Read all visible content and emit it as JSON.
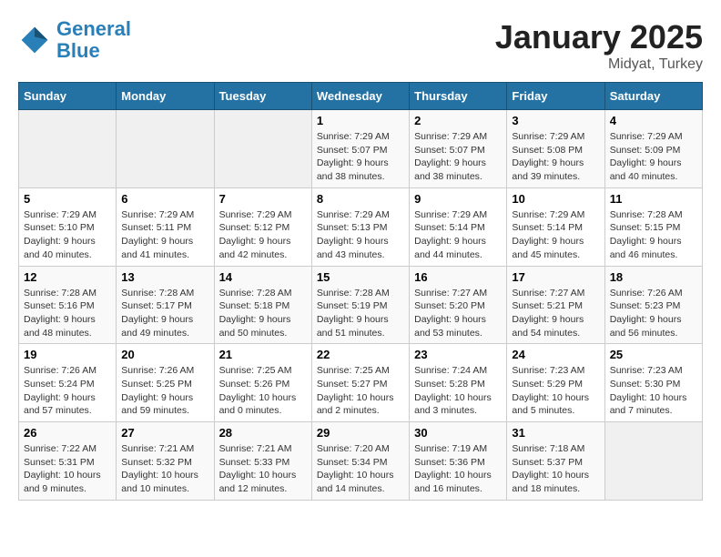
{
  "header": {
    "logo_line1": "General",
    "logo_line2": "Blue",
    "month": "January 2025",
    "location": "Midyat, Turkey"
  },
  "weekdays": [
    "Sunday",
    "Monday",
    "Tuesday",
    "Wednesday",
    "Thursday",
    "Friday",
    "Saturday"
  ],
  "weeks": [
    [
      {
        "day": "",
        "info": ""
      },
      {
        "day": "",
        "info": ""
      },
      {
        "day": "",
        "info": ""
      },
      {
        "day": "1",
        "info": "Sunrise: 7:29 AM\nSunset: 5:07 PM\nDaylight: 9 hours\nand 38 minutes."
      },
      {
        "day": "2",
        "info": "Sunrise: 7:29 AM\nSunset: 5:07 PM\nDaylight: 9 hours\nand 38 minutes."
      },
      {
        "day": "3",
        "info": "Sunrise: 7:29 AM\nSunset: 5:08 PM\nDaylight: 9 hours\nand 39 minutes."
      },
      {
        "day": "4",
        "info": "Sunrise: 7:29 AM\nSunset: 5:09 PM\nDaylight: 9 hours\nand 40 minutes."
      }
    ],
    [
      {
        "day": "5",
        "info": "Sunrise: 7:29 AM\nSunset: 5:10 PM\nDaylight: 9 hours\nand 40 minutes."
      },
      {
        "day": "6",
        "info": "Sunrise: 7:29 AM\nSunset: 5:11 PM\nDaylight: 9 hours\nand 41 minutes."
      },
      {
        "day": "7",
        "info": "Sunrise: 7:29 AM\nSunset: 5:12 PM\nDaylight: 9 hours\nand 42 minutes."
      },
      {
        "day": "8",
        "info": "Sunrise: 7:29 AM\nSunset: 5:13 PM\nDaylight: 9 hours\nand 43 minutes."
      },
      {
        "day": "9",
        "info": "Sunrise: 7:29 AM\nSunset: 5:14 PM\nDaylight: 9 hours\nand 44 minutes."
      },
      {
        "day": "10",
        "info": "Sunrise: 7:29 AM\nSunset: 5:14 PM\nDaylight: 9 hours\nand 45 minutes."
      },
      {
        "day": "11",
        "info": "Sunrise: 7:28 AM\nSunset: 5:15 PM\nDaylight: 9 hours\nand 46 minutes."
      }
    ],
    [
      {
        "day": "12",
        "info": "Sunrise: 7:28 AM\nSunset: 5:16 PM\nDaylight: 9 hours\nand 48 minutes."
      },
      {
        "day": "13",
        "info": "Sunrise: 7:28 AM\nSunset: 5:17 PM\nDaylight: 9 hours\nand 49 minutes."
      },
      {
        "day": "14",
        "info": "Sunrise: 7:28 AM\nSunset: 5:18 PM\nDaylight: 9 hours\nand 50 minutes."
      },
      {
        "day": "15",
        "info": "Sunrise: 7:28 AM\nSunset: 5:19 PM\nDaylight: 9 hours\nand 51 minutes."
      },
      {
        "day": "16",
        "info": "Sunrise: 7:27 AM\nSunset: 5:20 PM\nDaylight: 9 hours\nand 53 minutes."
      },
      {
        "day": "17",
        "info": "Sunrise: 7:27 AM\nSunset: 5:21 PM\nDaylight: 9 hours\nand 54 minutes."
      },
      {
        "day": "18",
        "info": "Sunrise: 7:26 AM\nSunset: 5:23 PM\nDaylight: 9 hours\nand 56 minutes."
      }
    ],
    [
      {
        "day": "19",
        "info": "Sunrise: 7:26 AM\nSunset: 5:24 PM\nDaylight: 9 hours\nand 57 minutes."
      },
      {
        "day": "20",
        "info": "Sunrise: 7:26 AM\nSunset: 5:25 PM\nDaylight: 9 hours\nand 59 minutes."
      },
      {
        "day": "21",
        "info": "Sunrise: 7:25 AM\nSunset: 5:26 PM\nDaylight: 10 hours\nand 0 minutes."
      },
      {
        "day": "22",
        "info": "Sunrise: 7:25 AM\nSunset: 5:27 PM\nDaylight: 10 hours\nand 2 minutes."
      },
      {
        "day": "23",
        "info": "Sunrise: 7:24 AM\nSunset: 5:28 PM\nDaylight: 10 hours\nand 3 minutes."
      },
      {
        "day": "24",
        "info": "Sunrise: 7:23 AM\nSunset: 5:29 PM\nDaylight: 10 hours\nand 5 minutes."
      },
      {
        "day": "25",
        "info": "Sunrise: 7:23 AM\nSunset: 5:30 PM\nDaylight: 10 hours\nand 7 minutes."
      }
    ],
    [
      {
        "day": "26",
        "info": "Sunrise: 7:22 AM\nSunset: 5:31 PM\nDaylight: 10 hours\nand 9 minutes."
      },
      {
        "day": "27",
        "info": "Sunrise: 7:21 AM\nSunset: 5:32 PM\nDaylight: 10 hours\nand 10 minutes."
      },
      {
        "day": "28",
        "info": "Sunrise: 7:21 AM\nSunset: 5:33 PM\nDaylight: 10 hours\nand 12 minutes."
      },
      {
        "day": "29",
        "info": "Sunrise: 7:20 AM\nSunset: 5:34 PM\nDaylight: 10 hours\nand 14 minutes."
      },
      {
        "day": "30",
        "info": "Sunrise: 7:19 AM\nSunset: 5:36 PM\nDaylight: 10 hours\nand 16 minutes."
      },
      {
        "day": "31",
        "info": "Sunrise: 7:18 AM\nSunset: 5:37 PM\nDaylight: 10 hours\nand 18 minutes."
      },
      {
        "day": "",
        "info": ""
      }
    ]
  ]
}
